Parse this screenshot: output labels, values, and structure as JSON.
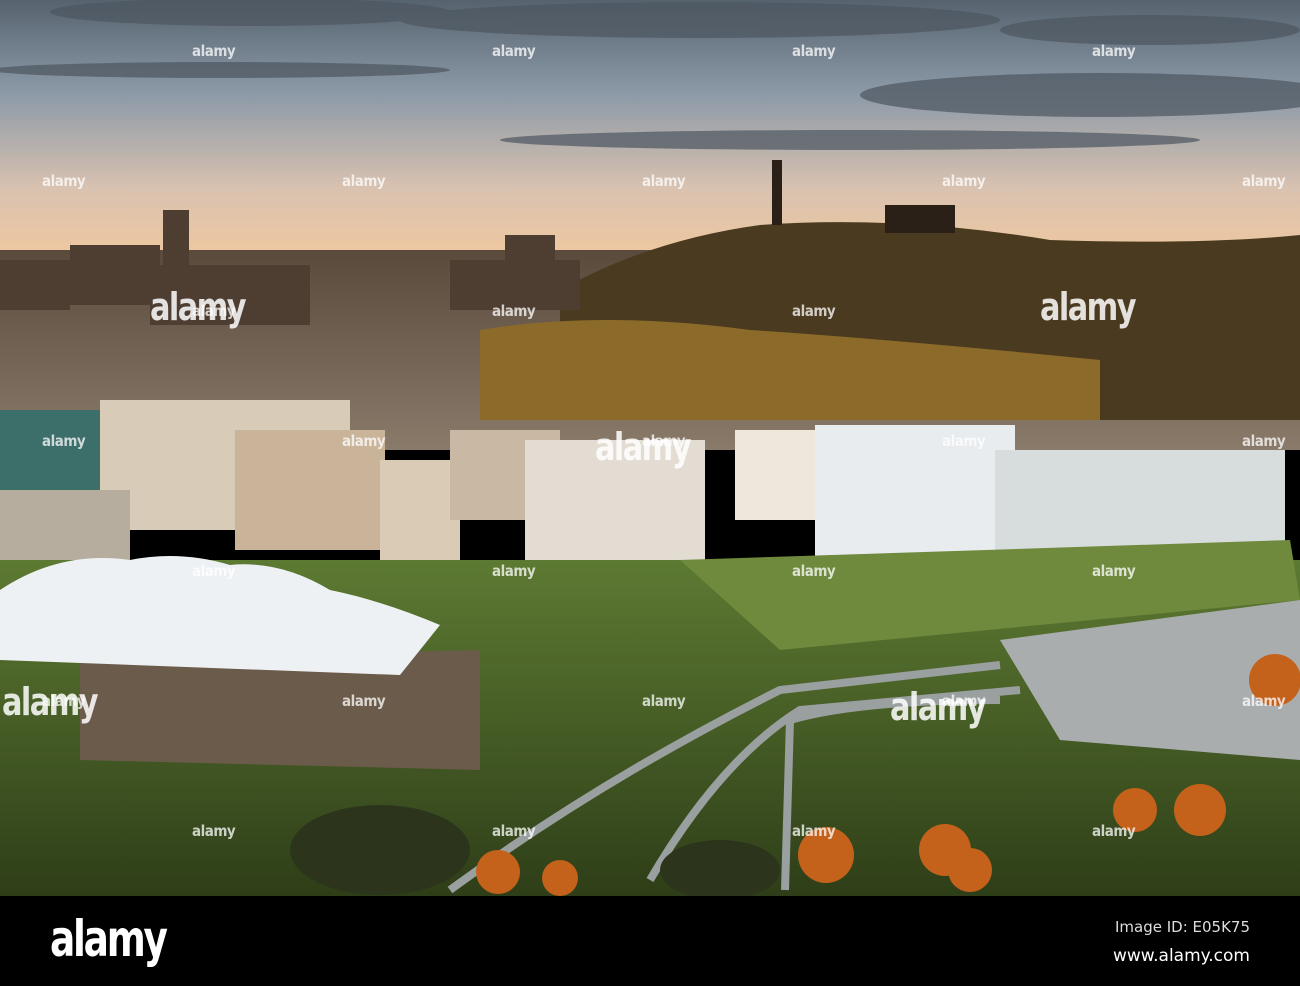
{
  "photo": {
    "subject": "Edinburgh skyline at sunset",
    "watermark_text": "alamy",
    "colors": {
      "sky_top": "#5f6d7e",
      "sky_horizon": "#f1c9a0",
      "hill": "#4a3a22",
      "grass": "#4f6a2a",
      "tent": "#eef1f4",
      "autumn": "#c4621c"
    }
  },
  "footer": {
    "logo": "alamy",
    "image_id": "Image ID: E05K75",
    "website": "www.alamy.com"
  }
}
